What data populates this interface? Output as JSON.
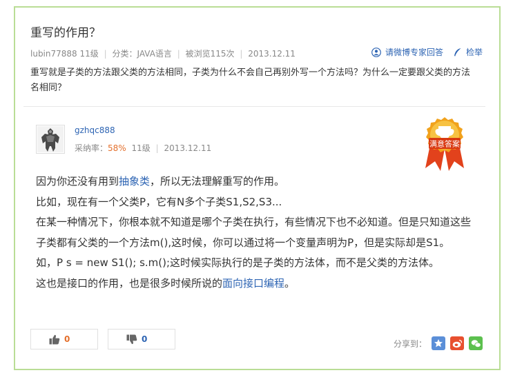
{
  "question": {
    "title": "重写的作用？",
    "user": "lubin77888",
    "level": "11级",
    "category": "分类：JAVA语言",
    "views": "被浏览115次",
    "date": "2013.12.11",
    "ask_expert": "请微博专家回答",
    "report": "检举",
    "body": "重写就是子类的方法跟父类的方法相同，子类为什么不会自己再别外写一个方法吗？为什么一定要跟父类的方法名相同？"
  },
  "answer": {
    "user": "gzhqc888",
    "rate_label": "采纳率：",
    "rate_value": "58%",
    "level": "11级",
    "date": "2013.12.11",
    "badge_text": "满意答案",
    "p1_a": "因为你还没有用到",
    "p1_link": "抽象类",
    "p1_b": "，所以无法理解重写的作用。",
    "p2": "比如，现在有一个父类P，它有N多个子类S1,S2,S3...",
    "p3": "在某一种情况下，你根本就不知道是哪个子类在执行，有些情况下也不必知道。但是只知道这些子类都有父类的一个方法m(),这时候，你可以通过将一个变量声明为P，但是实际却是S1。",
    "p4": "如，P s = new S1(); s.m();这时候实际执行的是子类的方法体，而不是父类的方法体。",
    "p5_a": "这也是接口的作用，也是很多时候所说的",
    "p5_link": "面向接口编程",
    "p5_b": "。"
  },
  "votes": {
    "up": "0",
    "down": "0"
  },
  "share": {
    "label": "分享到："
  },
  "colors": {
    "link": "#2d64b3",
    "accent": "#e46f2b",
    "frame": "#b9dd95"
  },
  "icons": [
    "user-icon",
    "feather-icon",
    "badge-icon",
    "thumbs-up-icon",
    "thumbs-down-icon",
    "qzone-icon",
    "weibo-icon",
    "wechat-icon"
  ]
}
